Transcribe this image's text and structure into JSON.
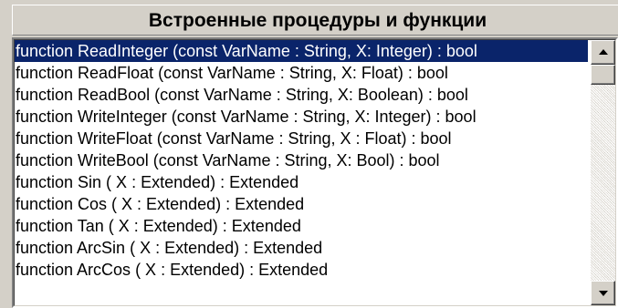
{
  "panel": {
    "title": "Встроенные процедуры и функции"
  },
  "list": {
    "selected_index": 0,
    "items": [
      "function  ReadInteger (const VarName : String, X: Integer) : bool",
      "function  ReadFloat (const VarName : String, X: Float)  : bool",
      "function  ReadBool (const VarName : String, X: Boolean)  : bool",
      "function  WriteInteger (const VarName : String,  X: Integer) : bool",
      "function  WriteFloat (const VarName : String, X : Float) : bool",
      "function  WriteBool (const VarName : String, X: Bool)  : bool",
      "function  Sin ( X : Extended) : Extended",
      "function  Cos ( X : Extended) : Extended",
      "function Tan ( X : Extended) : Extended",
      "function  ArcSin ( X : Extended) : Extended",
      "function  ArcCos ( X : Extended) : Extended"
    ]
  },
  "scrollbar": {
    "up_icon": "arrow-up-icon",
    "down_icon": "arrow-down-icon",
    "position": 0
  },
  "colors": {
    "selection_bg": "#0a246a",
    "selection_fg": "#ffffff",
    "face": "#d4d0c8"
  }
}
